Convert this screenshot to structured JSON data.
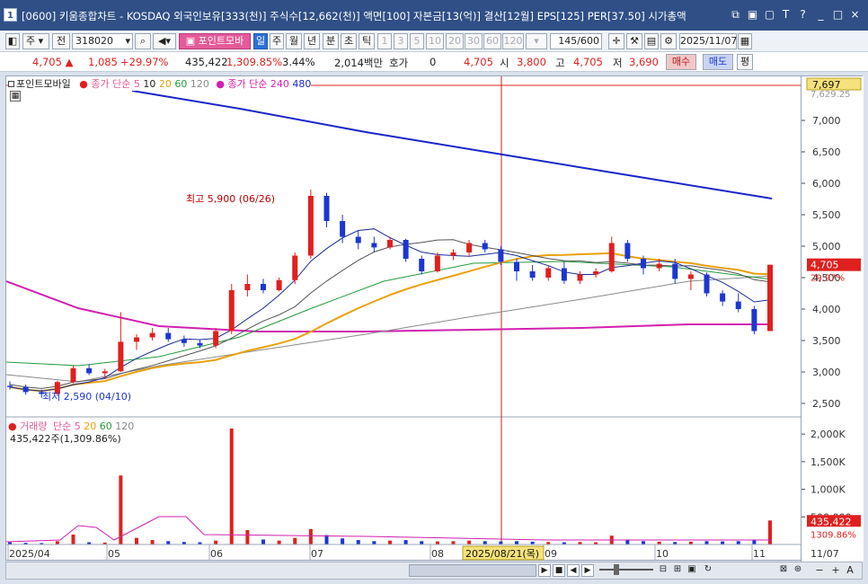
{
  "window": {
    "number": "1",
    "title": "[0600] 키움종합차트 - KOSDAQ 외국인보유[333(천)] 주식수[12,662(천)] 액면[100] 자본금[13(억)] 결산[12월] EPS[125] PER[37.50] 시가총액"
  },
  "toolbar": {
    "period_select": "주",
    "prev_label": "전",
    "code": "318020",
    "indicator_label": "포인트모바",
    "tabs": [
      "일",
      "주",
      "월",
      "년",
      "분",
      "초",
      "틱"
    ],
    "numbers": [
      "1",
      "3",
      "5",
      "10",
      "20",
      "30",
      "60",
      "120"
    ],
    "count": "145",
    "count_max": "/600",
    "date": "2025/11/07"
  },
  "quote": {
    "price": "4,705",
    "change": "1,085",
    "change_pct": "+29.97%",
    "volume": "435,422",
    "volume_pct": "1,309.85%",
    "turnover": "3.44%",
    "amount": "2,014백만",
    "hoga_label": "호가",
    "hoga_value": "0",
    "last": "4,705",
    "open_label": "시",
    "open": "3,800",
    "high_label": "고",
    "high": "4,705",
    "low_label": "저",
    "low": "3,690",
    "buy_label": "매수",
    "sell_label": "매도",
    "eval_label": "평"
  },
  "price_legend": {
    "name": "포인트모바일",
    "ma_label": "종가 단순",
    "ma_periods": [
      "5",
      "10",
      "20",
      "60",
      "120"
    ],
    "ma2_label": "종가 단순",
    "ma2_periods": [
      "240",
      "480"
    ]
  },
  "price_annotations": {
    "high_label": "최고 5,900 (06/26)",
    "low_label": "최저 2,590 (04/10)",
    "last_tag": "4,705",
    "last_pct": "29.97%",
    "top_tag": "7,697",
    "top_partial": "7,629.25"
  },
  "volume_legend": {
    "name": "거래량",
    "ma_label": "단순",
    "periods": [
      "5",
      "20",
      "60",
      "120"
    ],
    "summary": "435,422주(1,309.86%)",
    "last_tag": "435,422",
    "last_pct": "1309.86%"
  },
  "x_axis": {
    "labels": [
      "2025/04",
      "05",
      "06",
      "07",
      "08",
      "09",
      "10",
      "11",
      "11/07"
    ],
    "crosshair_label": "2025/08/21(목)"
  },
  "colors": {
    "up": "#e0201f",
    "down": "#1c36d2",
    "ma5": "#1c2a9a",
    "ma10": "#555555",
    "ma20": "#e8a10c",
    "ma60": "#239a3d",
    "ma120": "#8a8a8a",
    "ma240": "#d21fb0",
    "ma480": "#1a26c8"
  },
  "chart_data": {
    "type": "candlestick",
    "y_price_ticks": [
      "7,000",
      "6,500",
      "6,000",
      "5,500",
      "5,000",
      "4,500",
      "4,000",
      "3,500",
      "3,000",
      "2,500"
    ],
    "y_price_range": [
      2300,
      7700
    ],
    "y_volume_ticks": [
      "2,000K",
      "1,500K",
      "1,000K",
      "500,000"
    ],
    "y_volume_range": [
      0,
      2100000
    ],
    "candles": [
      [
        2780,
        2850,
        2720,
        2760
      ],
      [
        2760,
        2800,
        2640,
        2680
      ],
      [
        2680,
        2720,
        2590,
        2650
      ],
      [
        2650,
        2860,
        2640,
        2840
      ],
      [
        2840,
        3100,
        2820,
        3060
      ],
      [
        3060,
        3120,
        2950,
        2980
      ],
      [
        2980,
        3050,
        2900,
        3010
      ],
      [
        3010,
        3950,
        3000,
        3480
      ],
      [
        3480,
        3600,
        3350,
        3550
      ],
      [
        3550,
        3700,
        3500,
        3620
      ],
      [
        3620,
        3700,
        3480,
        3520
      ],
      [
        3520,
        3580,
        3400,
        3460
      ],
      [
        3460,
        3520,
        3380,
        3420
      ],
      [
        3420,
        3700,
        3380,
        3650
      ],
      [
        3650,
        4400,
        3600,
        4300
      ],
      [
        4300,
        4550,
        4200,
        4400
      ],
      [
        4400,
        4480,
        4250,
        4300
      ],
      [
        4300,
        4500,
        4280,
        4460
      ],
      [
        4460,
        4900,
        4400,
        4850
      ],
      [
        4850,
        5900,
        4800,
        5800
      ],
      [
        5800,
        5850,
        5300,
        5400
      ],
      [
        5400,
        5500,
        5050,
        5150
      ],
      [
        5150,
        5250,
        4950,
        5050
      ],
      [
        5050,
        5150,
        4900,
        4980
      ],
      [
        4980,
        5150,
        4950,
        5100
      ],
      [
        5100,
        5120,
        4750,
        4800
      ],
      [
        4800,
        4850,
        4550,
        4600
      ],
      [
        4600,
        4900,
        4580,
        4850
      ],
      [
        4850,
        4950,
        4780,
        4900
      ],
      [
        4900,
        5100,
        4850,
        5050
      ],
      [
        5050,
        5100,
        4900,
        4950
      ],
      [
        4950,
        5000,
        4700,
        4750
      ],
      [
        4750,
        4800,
        4450,
        4600
      ],
      [
        4600,
        4700,
        4450,
        4500
      ],
      [
        4500,
        4700,
        4450,
        4650
      ],
      [
        4650,
        4750,
        4400,
        4450
      ],
      [
        4450,
        4600,
        4400,
        4550
      ],
      [
        4550,
        4650,
        4500,
        4600
      ],
      [
        4600,
        5150,
        4580,
        5050
      ],
      [
        5050,
        5100,
        4750,
        4800
      ],
      [
        4800,
        4850,
        4550,
        4650
      ],
      [
        4650,
        4800,
        4600,
        4720
      ],
      [
        4720,
        4800,
        4400,
        4480
      ],
      [
        4480,
        4600,
        4300,
        4550
      ],
      [
        4550,
        4580,
        4200,
        4250
      ],
      [
        4250,
        4300,
        4050,
        4120
      ],
      [
        4120,
        4250,
        3950,
        4000
      ],
      [
        4000,
        4050,
        3600,
        3650
      ],
      [
        3650,
        4705,
        3690,
        4705
      ]
    ],
    "volume_k": [
      40,
      30,
      25,
      60,
      180,
      40,
      35,
      1250,
      120,
      80,
      60,
      45,
      40,
      70,
      2100,
      260,
      90,
      70,
      120,
      280,
      170,
      110,
      80,
      60,
      70,
      80,
      60,
      55,
      60,
      70,
      60,
      55,
      60,
      50,
      45,
      40,
      45,
      40,
      160,
      90,
      60,
      50,
      45,
      50,
      60,
      55,
      60,
      90,
      435
    ]
  }
}
